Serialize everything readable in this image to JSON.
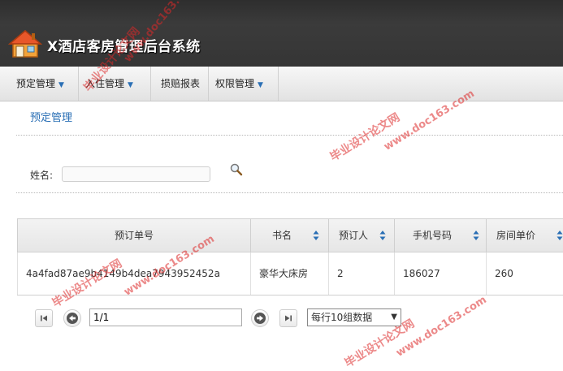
{
  "header": {
    "title": "X酒店客房管理后台系统",
    "logo_icon": "house-icon"
  },
  "nav": {
    "items": [
      {
        "label": "预定管理",
        "has_dropdown": true
      },
      {
        "label": "入住管理",
        "has_dropdown": true
      },
      {
        "label": "损赔报表",
        "has_dropdown": false
      },
      {
        "label": "权限管理",
        "has_dropdown": true
      }
    ]
  },
  "section": {
    "title": "预定管理"
  },
  "search": {
    "label": "姓名:",
    "value": "",
    "icon": "magnifier-icon"
  },
  "table": {
    "columns": [
      "预订单号",
      "书名",
      "预订人",
      "手机号码",
      "房间单价"
    ],
    "rows": [
      [
        "4a4fad87ae9b4149b4dea7943952452a",
        "豪华大床房",
        "2",
        "186027",
        "260"
      ]
    ]
  },
  "pagination": {
    "page_value": "1/1",
    "rows_per_page": "每行10组数据"
  },
  "watermarks": {
    "cn": "毕业设计论文网",
    "url": "www.doc163.com"
  },
  "colors": {
    "accent": "#2a6fb5",
    "header_bg": "#333333",
    "watermark": "#dc2828"
  }
}
